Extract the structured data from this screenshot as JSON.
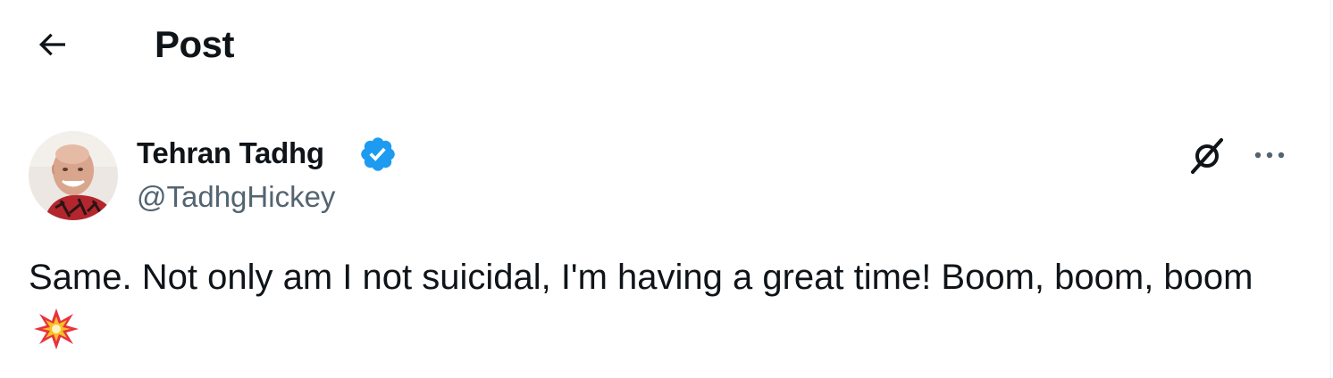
{
  "header": {
    "back_icon": "arrow-left-icon",
    "title": "Post"
  },
  "author": {
    "display_name": "Tehran Tadhg",
    "handle": "@TadhgHickey",
    "verified": true,
    "verified_color": "#1d9bf0"
  },
  "actions": {
    "grok_icon": "grok-slash-icon",
    "more_icon": "more-dots-icon"
  },
  "post": {
    "text": "Same. Not only am I not suicidal, I'm having a great time! Boom, boom, boom",
    "emoji": "collision-emoji"
  },
  "colors": {
    "text": "#0f1419",
    "secondary": "#536471",
    "accent": "#1d9bf0"
  }
}
